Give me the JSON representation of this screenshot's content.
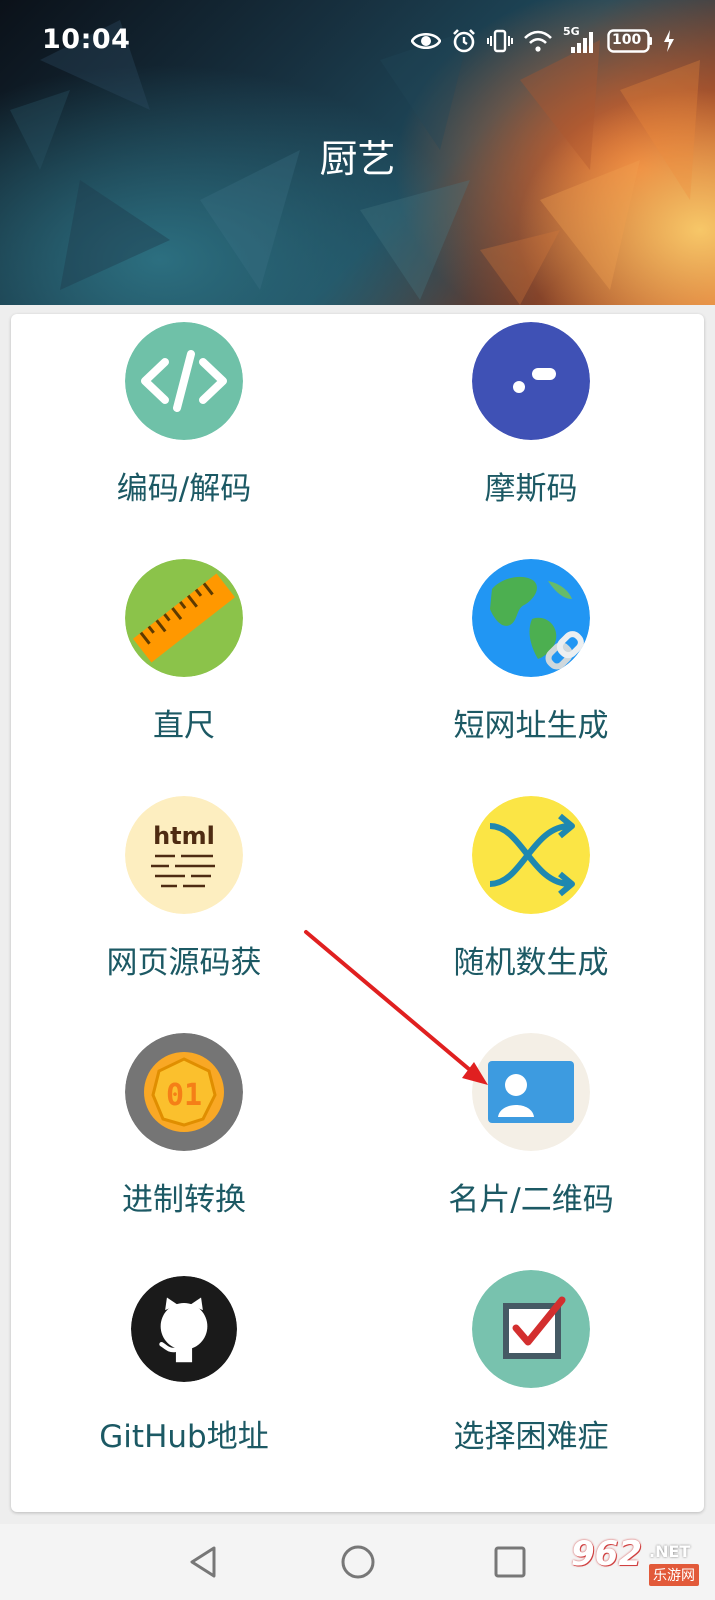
{
  "status_bar": {
    "time": "10:04",
    "network": "5G",
    "battery": "100",
    "icons": [
      "eye-icon",
      "alarm-icon",
      "vibrate-icon",
      "wifi-icon",
      "signal-icon",
      "battery-icon",
      "charging-icon"
    ]
  },
  "header": {
    "title": "厨艺"
  },
  "tools": [
    {
      "label": "编码/解码",
      "icon": "code-icon",
      "color": "#6fc1a8"
    },
    {
      "label": "摩斯码",
      "icon": "morse-icon",
      "color": "#3f51b5"
    },
    {
      "label": "直尺",
      "icon": "ruler-icon",
      "color": "#8bc34a"
    },
    {
      "label": "短网址生成",
      "icon": "globe-link-icon",
      "color": "#2196f3"
    },
    {
      "label": "网页源码获",
      "icon": "html-paper-icon",
      "color": "#fdeec0"
    },
    {
      "label": "随机数生成",
      "icon": "shuffle-icon",
      "color": "#fbe545"
    },
    {
      "label": "进制转换",
      "icon": "binary-coin-icon",
      "color": "#757575"
    },
    {
      "label": "名片/二维码",
      "icon": "contact-card-icon",
      "color": "#f4efe6"
    },
    {
      "label": "GitHub地址",
      "icon": "github-icon",
      "color": "#1a1a1a"
    },
    {
      "label": "选择困难症",
      "icon": "checkbox-icon",
      "color": "#78c2ae"
    }
  ],
  "nav": {
    "icons": [
      "back-icon",
      "home-icon",
      "recents-icon"
    ]
  },
  "watermark": {
    "number": "962",
    "net": ".NET",
    "cn": "乐游网"
  },
  "colors": {
    "label_text": "#1c5964",
    "card_bg": "#ffffff",
    "page_bg": "#eeeeee",
    "annotation_arrow": "#e02020"
  }
}
